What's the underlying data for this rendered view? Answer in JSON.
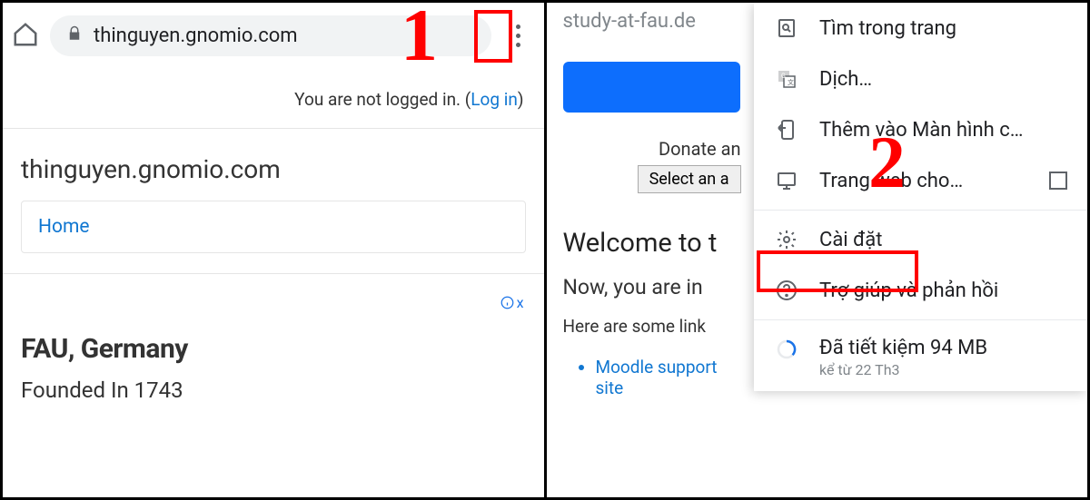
{
  "left": {
    "url": "thinguyen.gnomio.com",
    "login_text": "You are not logged in. (",
    "login_link": "Log in",
    "login_paren": ")",
    "site_title": "thinguyen.gnomio.com",
    "nav_home": "Home",
    "ad_marker": "x",
    "ad_title": "FAU, Germany",
    "ad_sub": "Founded In 1743",
    "step": "1"
  },
  "right": {
    "url_hint": "study-at-fau.de",
    "donate": "Donate an",
    "select": "Select an a",
    "welcome": "Welcome to t",
    "now": "Now, you are in",
    "here": "Here are some link",
    "support_link": "Moodle support site",
    "step": "2"
  },
  "menu": {
    "find": "Tìm trong trang",
    "translate": "Dịch…",
    "add_home": "Thêm vào Màn hình c…",
    "desktop": "Trang web cho…",
    "settings": "Cài đặt",
    "help": "Trợ giúp và phản hồi",
    "data_saved": "Đã tiết kiệm 94 MB",
    "data_since": "kể từ 22 Th3"
  }
}
